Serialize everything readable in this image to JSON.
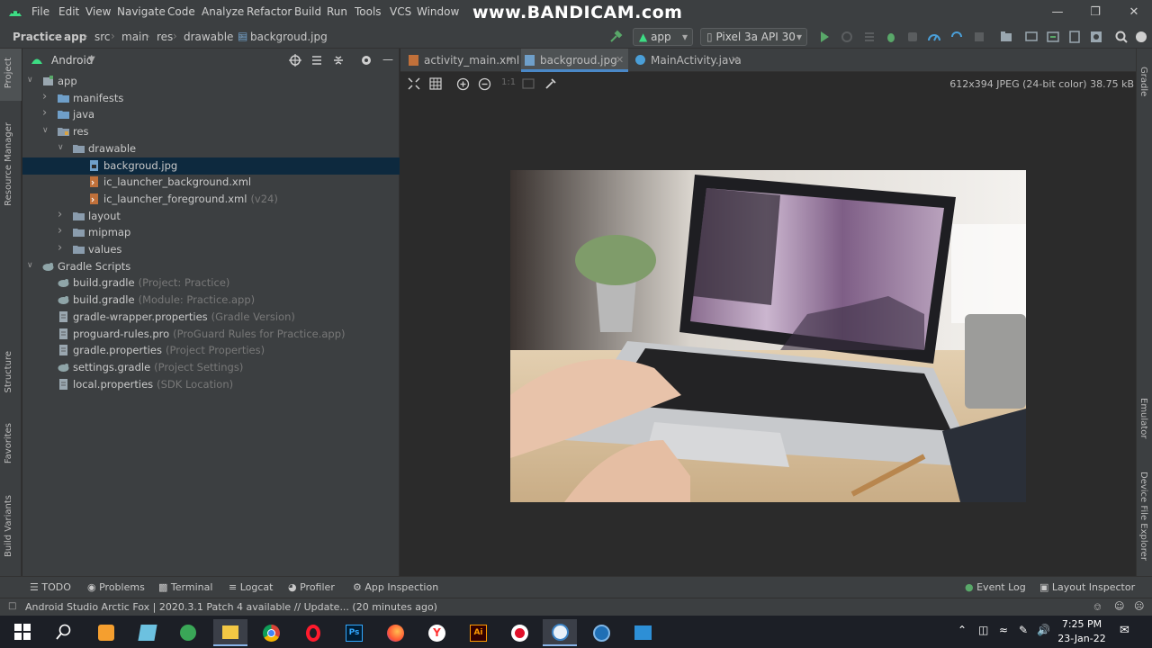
{
  "menubar": {
    "items": [
      "File",
      "Edit",
      "View",
      "Navigate",
      "Code",
      "Analyze",
      "Refactor",
      "Build",
      "Run",
      "Tools",
      "VCS",
      "Window"
    ],
    "watermark": "www.BANDICAM.com"
  },
  "navbar": {
    "breadcrumbs": [
      "Practice",
      "app",
      "src",
      "main",
      "res",
      "drawable",
      "backgroud.jpg"
    ],
    "run_config": "app",
    "device": "Pixel 3a API 30"
  },
  "left_strip": {
    "project": "Project",
    "resource_manager": "Resource Manager",
    "structure": "Structure",
    "favorites": "Favorites",
    "build_variants": "Build Variants"
  },
  "right_strip": {
    "gradle": "Gradle",
    "emulator": "Emulator",
    "device_file_explorer": "Device File Explorer"
  },
  "project_panel": {
    "view_mode": "Android",
    "tree": [
      {
        "label": "app",
        "hint": "",
        "depth": 0,
        "arrow": "down",
        "icon": "module"
      },
      {
        "label": "manifests",
        "hint": "",
        "depth": 1,
        "arrow": "right",
        "icon": "folder-blue"
      },
      {
        "label": "java",
        "hint": "",
        "depth": 1,
        "arrow": "right",
        "icon": "folder-blue"
      },
      {
        "label": "res",
        "hint": "",
        "depth": 1,
        "arrow": "down",
        "icon": "folder-res"
      },
      {
        "label": "drawable",
        "hint": "",
        "depth": 2,
        "arrow": "down",
        "icon": "folder"
      },
      {
        "label": "backgroud.jpg",
        "hint": "",
        "depth": 3,
        "arrow": "",
        "icon": "image-file",
        "selected": true
      },
      {
        "label": "ic_launcher_background.xml",
        "hint": "",
        "depth": 3,
        "arrow": "",
        "icon": "xml-file"
      },
      {
        "label": "ic_launcher_foreground.xml",
        "hint": "(v24)",
        "depth": 3,
        "arrow": "",
        "icon": "xml-file"
      },
      {
        "label": "layout",
        "hint": "",
        "depth": 2,
        "arrow": "right",
        "icon": "folder"
      },
      {
        "label": "mipmap",
        "hint": "",
        "depth": 2,
        "arrow": "right",
        "icon": "folder"
      },
      {
        "label": "values",
        "hint": "",
        "depth": 2,
        "arrow": "right",
        "icon": "folder"
      },
      {
        "label": "Gradle Scripts",
        "hint": "",
        "depth": 0,
        "arrow": "down",
        "icon": "gradle"
      },
      {
        "label": "build.gradle",
        "hint": "(Project: Practice)",
        "depth": 1,
        "arrow": "",
        "icon": "gradle"
      },
      {
        "label": "build.gradle",
        "hint": "(Module: Practice.app)",
        "depth": 1,
        "arrow": "",
        "icon": "gradle"
      },
      {
        "label": "gradle-wrapper.properties",
        "hint": "(Gradle Version)",
        "depth": 1,
        "arrow": "",
        "icon": "properties"
      },
      {
        "label": "proguard-rules.pro",
        "hint": "(ProGuard Rules for Practice.app)",
        "depth": 1,
        "arrow": "",
        "icon": "properties"
      },
      {
        "label": "gradle.properties",
        "hint": "(Project Properties)",
        "depth": 1,
        "arrow": "",
        "icon": "properties"
      },
      {
        "label": "settings.gradle",
        "hint": "(Project Settings)",
        "depth": 1,
        "arrow": "",
        "icon": "gradle"
      },
      {
        "label": "local.properties",
        "hint": "(SDK Location)",
        "depth": 1,
        "arrow": "",
        "icon": "properties"
      }
    ]
  },
  "editor": {
    "tabs": [
      {
        "label": "activity_main.xml",
        "active": false
      },
      {
        "label": "backgroud.jpg",
        "active": true
      },
      {
        "label": "MainActivity.java",
        "active": false
      }
    ],
    "zoom_actual": "1:1",
    "image_info": "612x394 JPEG (24-bit color) 38.75 kB"
  },
  "bottom_tabs": {
    "todo": "TODO",
    "problems": "Problems",
    "terminal": "Terminal",
    "logcat": "Logcat",
    "profiler": "Profiler",
    "app_inspection": "App Inspection",
    "event_log": "Event Log",
    "layout_inspector": "Layout Inspector"
  },
  "status": {
    "message": "Android Studio Arctic Fox | 2020.3.1 Patch 4 available // Update... (20 minutes ago)"
  },
  "taskbar": {
    "time": "7:25 PM",
    "date": "23-Jan-22",
    "photoshop_label": "Ps",
    "illustrator_label": "Ai"
  },
  "colors": {
    "accent": "#4a88c7",
    "panel": "#3c3f41",
    "editor_bg": "#2b2b2b",
    "selection": "#0d293e",
    "run_green": "#59a869"
  }
}
